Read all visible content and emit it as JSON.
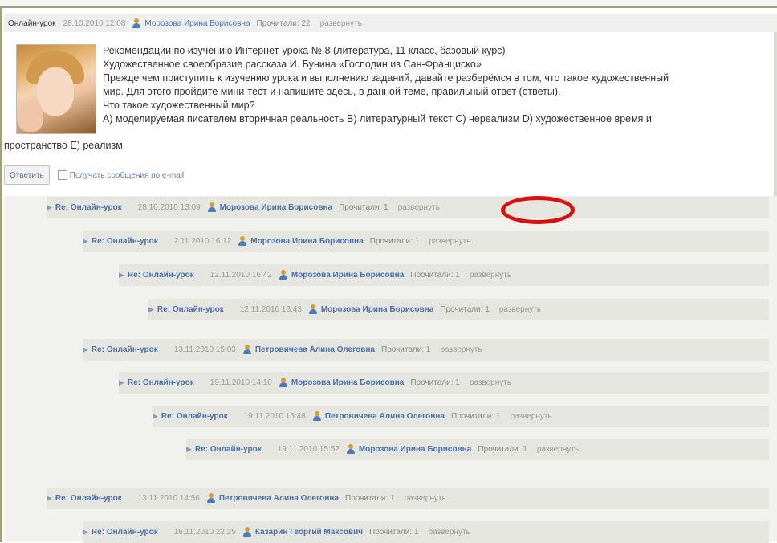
{
  "post": {
    "title": "Онлайн-урок",
    "date": "28.10.2010 12:08",
    "author": "Морозова Ирина Борисовна",
    "reads": "Прочитали: 22",
    "expand": "развернуть",
    "body_lines": [
      "Рекомендации по изучению Интернет-урока № 8 (литература, 11 класс, базовый курс)",
      "Художественное своеобразие рассказа И. Бунина «Господин из Сан-Франциско»",
      "Прежде чем приступить к изучению урока и выполнению заданий, давайте разберёмся в том, что такое художественный",
      "мир. Для этого пройдите мини-тест и напишите здесь, в данной теме, правильный ответ (ответы).",
      "Что такое художественный мир?",
      "А) моделируемая писателем вторичная реальность В) литературный текст С) нереализм D) художественное время и"
    ],
    "body_last": "пространство Е) реализм",
    "reply_button": "Ответить",
    "email_checkbox": "Получать сообщения по e-mail"
  },
  "replies": [
    {
      "title": "Re: Онлайн-урок",
      "date": "28.10.2010 13:09",
      "author": "Морозова Ирина Борисовна",
      "reads": "Прочитали: 1",
      "expand": "развернуть"
    },
    {
      "title": "Re: Онлайн-урок",
      "date": "2.11.2010 16:12",
      "author": "Морозова Ирина Борисовна",
      "reads": "Прочитали: 1",
      "expand": "развернуть"
    },
    {
      "title": "Re: Онлайн-урок",
      "date": "12.11.2010 16:42",
      "author": "Морозова Ирина Борисовна",
      "reads": "Прочитали: 1",
      "expand": "развернуть"
    },
    {
      "title": "Re: Онлайн-урок",
      "date": "12.11.2010 16:43",
      "author": "Морозова Ирина Борисовна",
      "reads": "Прочитали: 1",
      "expand": "развернуть"
    },
    {
      "title": "Re: Онлайн-урок",
      "date": "13.11.2010 15:03",
      "author": "Петровичева Алина Олеговна",
      "reads": "Прочитали: 1",
      "expand": "развернуть"
    },
    {
      "title": "Re: Онлайн-урок",
      "date": "19.11.2010 14:10",
      "author": "Морозова Ирина Борисовна",
      "reads": "Прочитали: 1",
      "expand": "развернуть"
    },
    {
      "title": "Re: Онлайн-урок",
      "date": "19.11.2010 15:48",
      "author": "Петровичева Алина Олеговна",
      "reads": "Прочитали: 1",
      "expand": "развернуть"
    },
    {
      "title": "Re: Онлайн-урок",
      "date": "19.11.2010 15:52",
      "author": "Морозова Ирина Борисовна",
      "reads": "Прочитали: 1",
      "expand": "развернуть"
    },
    {
      "title": "Re: Онлайн-урок",
      "date": "13.11.2010 14:56",
      "author": "Петровичева Алина Олеговна",
      "reads": "Прочитали: 1",
      "expand": "развернуть"
    },
    {
      "title": "Re: Онлайн-урок",
      "date": "16.11.2010 22:25",
      "author": "Казарин Георгий Максович",
      "reads": "Прочитали: 1",
      "expand": "развернуть"
    }
  ],
  "colors": {
    "link": "#4b6fa8",
    "highlight_circle": "#d81010",
    "row_bg": "#e6e6e1"
  }
}
